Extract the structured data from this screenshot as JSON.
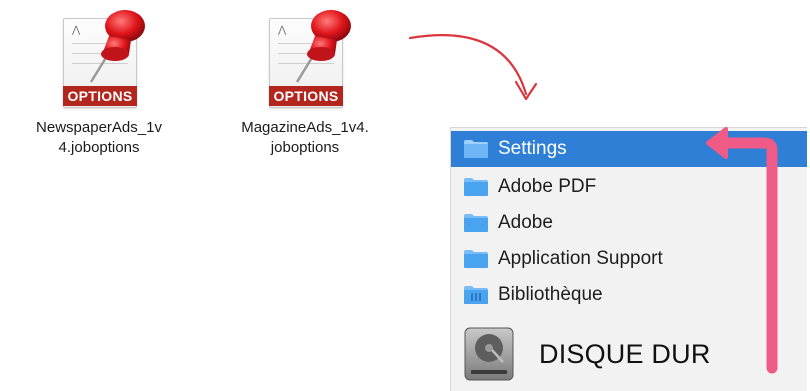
{
  "files": [
    {
      "icon": "joboptions-icon",
      "badge": "OPTIONS",
      "name": "NewspaperAds_1v\n4.joboptions"
    },
    {
      "icon": "joboptions-icon",
      "badge": "OPTIONS",
      "name": "MagazineAds_1v4.\njoboptions"
    }
  ],
  "path_panel": {
    "items": [
      {
        "label": "Settings",
        "icon": "folder-icon",
        "selected": true
      },
      {
        "label": "Adobe PDF",
        "icon": "folder-icon",
        "selected": false
      },
      {
        "label": "Adobe",
        "icon": "folder-icon",
        "selected": false
      },
      {
        "label": "Application Support",
        "icon": "folder-icon",
        "selected": false
      },
      {
        "label": "Bibliothèque",
        "icon": "library-folder-icon",
        "selected": false
      }
    ],
    "drive": {
      "label": "DISQUE DUR",
      "icon": "hard-drive-icon"
    }
  },
  "colors": {
    "selection": "#2f7fd6",
    "arrow_red": "#d9363e",
    "arrow_pink": "#f05a86",
    "options_band": "#b3261e"
  }
}
